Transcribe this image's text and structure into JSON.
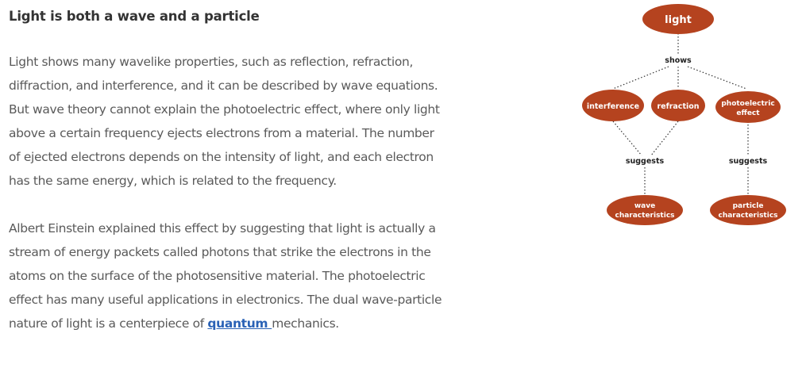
{
  "article": {
    "title": "Light is both a wave and a particle",
    "paragraph1": "Light shows many wavelike properties, such as reflection, refraction, diffraction, and interference, and it can be described by wave equations. But wave theory cannot explain the photoelectric effect, where only light above a certain frequency ejects electrons from a material. The number of ejected electrons depends on the intensity of light, and each electron has the same energy, which is related to the frequency.",
    "paragraph2_before_link": "Albert Einstein explained this effect by suggesting that light is actually a stream of energy packets called photons that strike the electrons in the atoms on the surface of the photosensitive material. The photoelectric effect has many useful applications in electronics. The dual wave-particle nature of light is a centerpiece of ",
    "link_text": "quantum ",
    "paragraph2_after_link": "mechanics."
  },
  "diagram": {
    "colors": {
      "node": "#b5431f",
      "connector": "#333333"
    },
    "nodes": {
      "light": "light",
      "interference": "interference",
      "refraction": "refraction",
      "photoelectric_line1": "photoelectric",
      "photoelectric_line2": "effect",
      "wave_line1": "wave",
      "wave_line2": "characteristics",
      "particle_line1": "particle",
      "particle_line2": "characteristics"
    },
    "connectors": {
      "shows": "shows",
      "suggests_left": "suggests",
      "suggests_right": "suggests"
    }
  }
}
